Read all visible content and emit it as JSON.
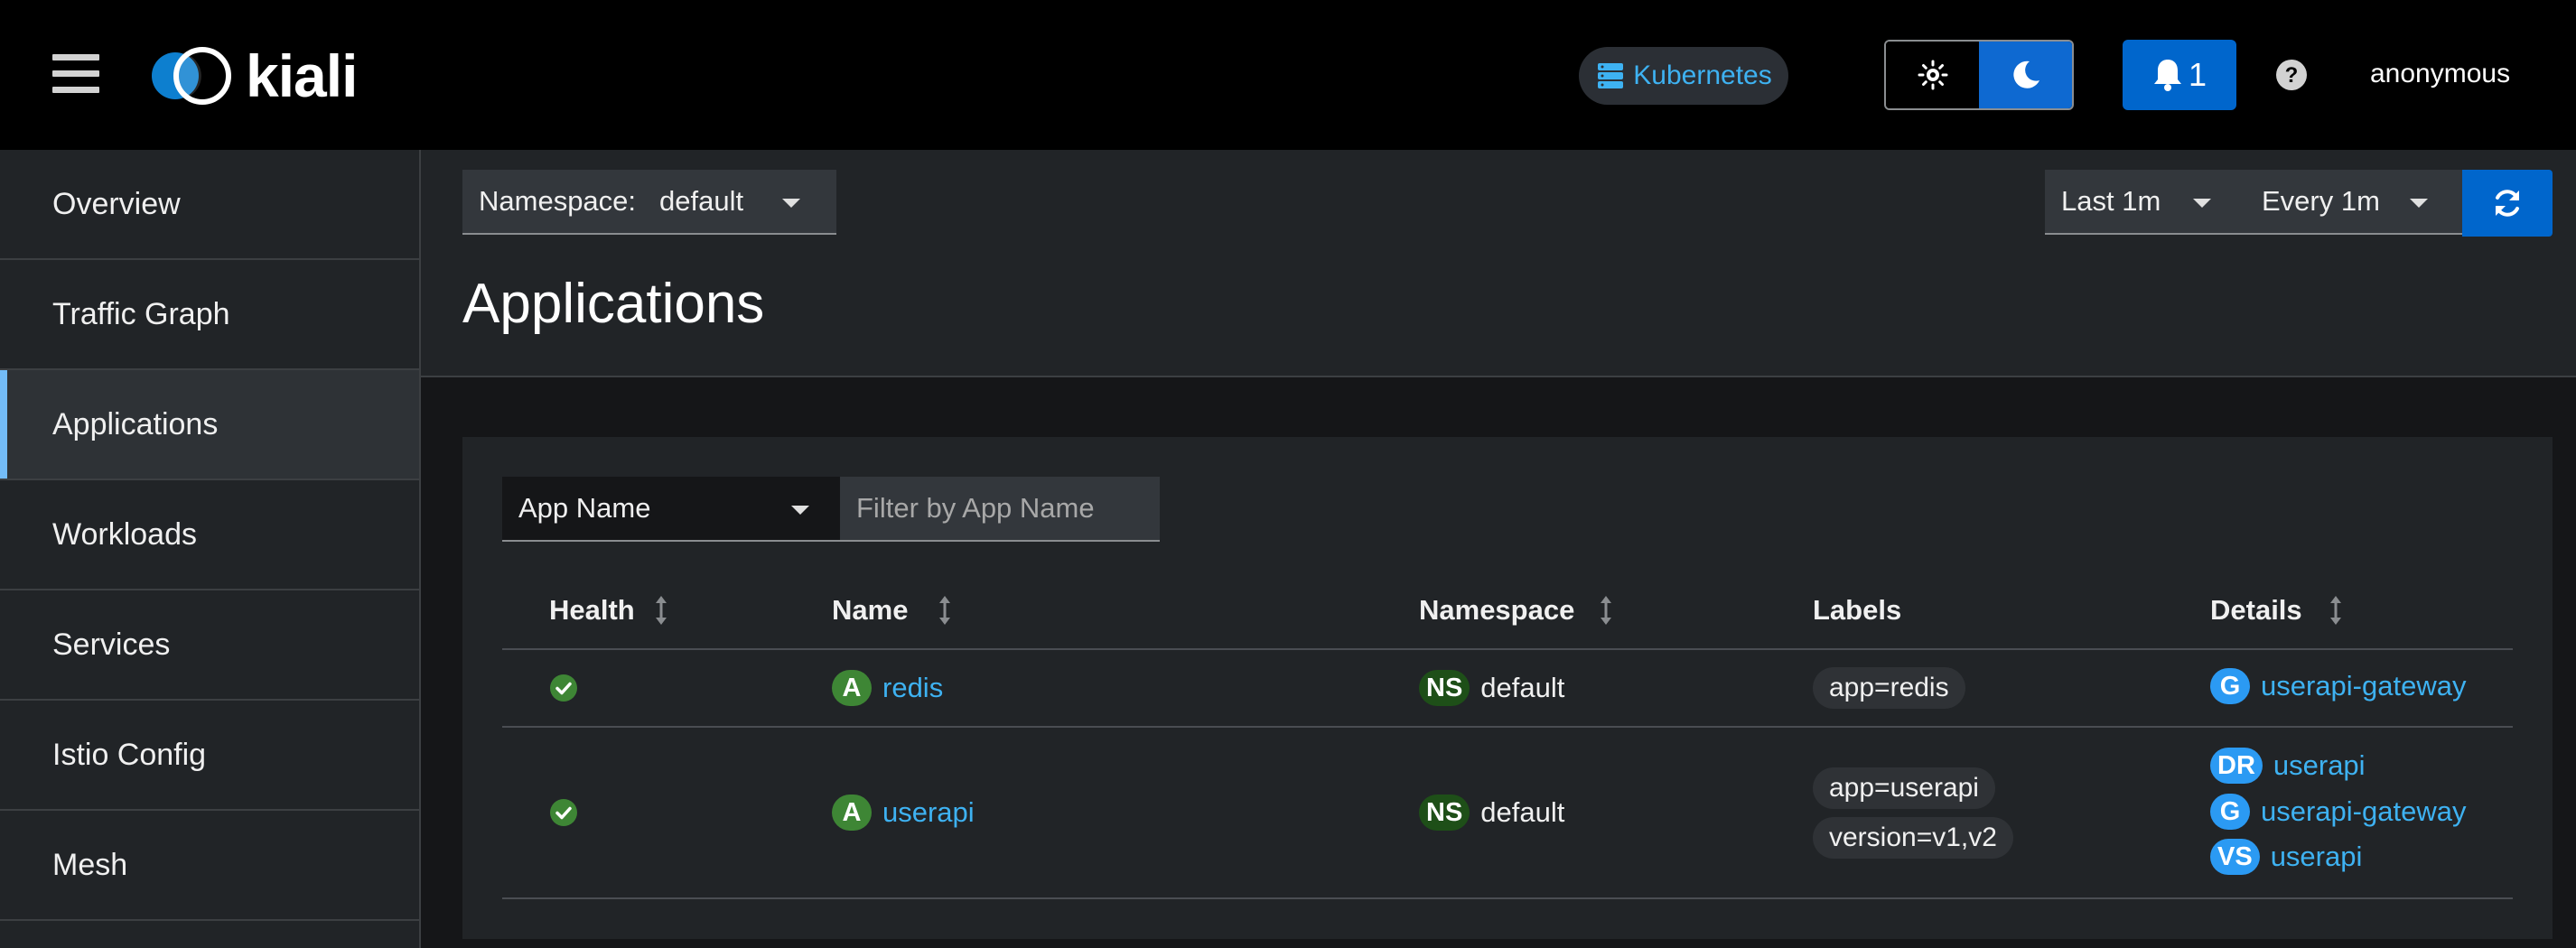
{
  "header": {
    "app_name": "kiali",
    "cluster": "Kubernetes",
    "notification_count": "1",
    "user": "anonymous"
  },
  "sidebar": {
    "items": [
      {
        "label": "Overview"
      },
      {
        "label": "Traffic Graph"
      },
      {
        "label": "Applications",
        "active": true
      },
      {
        "label": "Workloads"
      },
      {
        "label": "Services"
      },
      {
        "label": "Istio Config"
      },
      {
        "label": "Mesh"
      }
    ]
  },
  "toolbar": {
    "namespace_label": "Namespace:",
    "namespace_value": "default",
    "time_range": "Last 1m",
    "refresh_interval": "Every 1m"
  },
  "page": {
    "title": "Applications"
  },
  "filter": {
    "type": "App Name",
    "placeholder": "Filter by App Name"
  },
  "table": {
    "columns": [
      "Health",
      "Name",
      "Namespace",
      "Labels",
      "Details"
    ],
    "rows": [
      {
        "health": "healthy",
        "name_badge": "A",
        "name": "redis",
        "ns_badge": "NS",
        "namespace": "default",
        "labels": [
          "app=redis"
        ],
        "details": [
          {
            "badge": "G",
            "name": "userapi-gateway"
          }
        ]
      },
      {
        "health": "healthy",
        "name_badge": "A",
        "name": "userapi",
        "ns_badge": "NS",
        "namespace": "default",
        "labels": [
          "app=userapi",
          "version=v1,v2"
        ],
        "details": [
          {
            "badge": "DR",
            "name": "userapi"
          },
          {
            "badge": "G",
            "name": "userapi-gateway"
          },
          {
            "badge": "VS",
            "name": "userapi"
          }
        ]
      }
    ]
  },
  "colors": {
    "accent": "#0066cc",
    "link": "#3eb2f2",
    "healthy": "#3e8635",
    "active_indicator": "#73bcf7"
  },
  "icons": {
    "menu": "hamburger-icon",
    "cluster": "server-icon",
    "light_theme": "sun-icon",
    "dark_theme": "moon-icon",
    "notifications": "bell-icon",
    "help": "question-circle-icon",
    "refresh": "sync-icon",
    "health": "check-circle-icon",
    "sort": "sort-icon"
  }
}
